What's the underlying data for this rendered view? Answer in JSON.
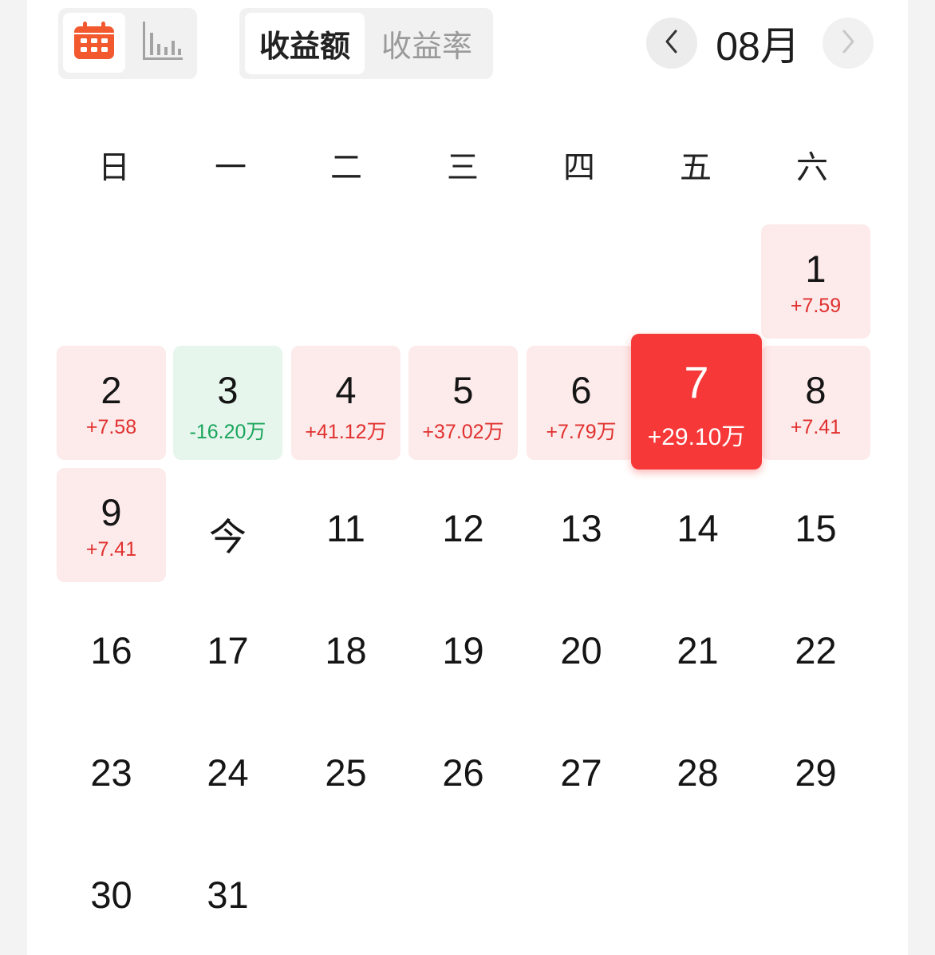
{
  "toolbar": {
    "views": [
      {
        "icon": "calendar-icon",
        "active": true,
        "accent": "#f3592e"
      },
      {
        "icon": "bar-chart-icon",
        "active": false
      }
    ],
    "metrics": [
      {
        "label": "收益额",
        "active": true
      },
      {
        "label": "收益率",
        "active": false
      }
    ],
    "month": "08月"
  },
  "weekdays": [
    "日",
    "一",
    "二",
    "三",
    "四",
    "五",
    "六"
  ],
  "colors": {
    "gain_bg": "#fdeaea",
    "gain_text": "#e0312f",
    "loss_bg": "#e6f6ed",
    "loss_text": "#1ba55c",
    "selected_bg": "#f63838"
  },
  "days": [
    {
      "day": "1",
      "value": "+7.59",
      "state": "gain"
    },
    {
      "day": "2",
      "value": "+7.58",
      "state": "gain"
    },
    {
      "day": "3",
      "value": "-16.20万",
      "state": "loss"
    },
    {
      "day": "4",
      "value": "+41.12万",
      "state": "gain"
    },
    {
      "day": "5",
      "value": "+37.02万",
      "state": "gain"
    },
    {
      "day": "6",
      "value": "+7.79万",
      "state": "gain"
    },
    {
      "day": "7",
      "value": "+29.10万",
      "state": "selected"
    },
    {
      "day": "8",
      "value": "+7.41",
      "state": "gain"
    },
    {
      "day": "9",
      "value": "+7.41",
      "state": "gain"
    },
    {
      "day": "今",
      "value": "",
      "state": "today"
    },
    {
      "day": "11",
      "value": "",
      "state": "none"
    },
    {
      "day": "12",
      "value": "",
      "state": "none"
    },
    {
      "day": "13",
      "value": "",
      "state": "none"
    },
    {
      "day": "14",
      "value": "",
      "state": "none"
    },
    {
      "day": "15",
      "value": "",
      "state": "none"
    },
    {
      "day": "16",
      "value": "",
      "state": "none"
    },
    {
      "day": "17",
      "value": "",
      "state": "none"
    },
    {
      "day": "18",
      "value": "",
      "state": "none"
    },
    {
      "day": "19",
      "value": "",
      "state": "none"
    },
    {
      "day": "20",
      "value": "",
      "state": "none"
    },
    {
      "day": "21",
      "value": "",
      "state": "none"
    },
    {
      "day": "22",
      "value": "",
      "state": "none"
    },
    {
      "day": "23",
      "value": "",
      "state": "none"
    },
    {
      "day": "24",
      "value": "",
      "state": "none"
    },
    {
      "day": "25",
      "value": "",
      "state": "none"
    },
    {
      "day": "26",
      "value": "",
      "state": "none"
    },
    {
      "day": "27",
      "value": "",
      "state": "none"
    },
    {
      "day": "28",
      "value": "",
      "state": "none"
    },
    {
      "day": "29",
      "value": "",
      "state": "none"
    },
    {
      "day": "30",
      "value": "",
      "state": "none"
    },
    {
      "day": "31",
      "value": "",
      "state": "none"
    }
  ],
  "first_weekday": 6
}
